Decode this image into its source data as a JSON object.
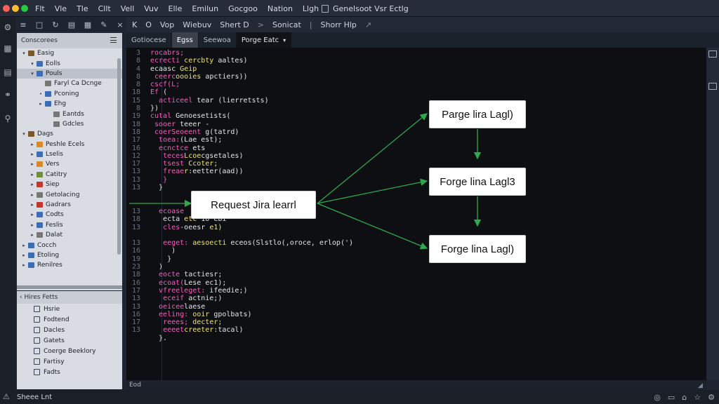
{
  "window": {
    "title": "Genelsoot Vsr Ectlg",
    "menu": [
      "Flt",
      "Vle",
      "Tle",
      "Cllt",
      "Vell",
      "Vuv",
      "Elle",
      "Emilun",
      "Gocgoo",
      "Nation",
      "Llgh"
    ]
  },
  "toolbar": {
    "items": [
      "K",
      "O",
      "Vop",
      "Wiebuv",
      "Shert D",
      "Sonicat",
      "Shorr Hlp"
    ],
    "separators": [
      ">",
      "|",
      "↗"
    ]
  },
  "panel_tools": [
    "≡",
    "□",
    "↻",
    "▤",
    "▦",
    "✎",
    "×"
  ],
  "tabs": {
    "items": [
      {
        "label": "Gotiocese",
        "active": false
      },
      {
        "label": "Egss",
        "active": true
      },
      {
        "label": "Seewoa",
        "active": false
      },
      {
        "label": "Porge Eatc",
        "active": false
      }
    ]
  },
  "explorer": {
    "title": "Conscorees",
    "tree": [
      {
        "label": "Easig",
        "depth": 0,
        "caret": "▾",
        "color": "#7a5a2a",
        "selected": false
      },
      {
        "label": "Eolls",
        "depth": 1,
        "caret": "▾",
        "color": "#3d6db3",
        "selected": false
      },
      {
        "label": "Pouls",
        "depth": 1,
        "caret": "▾",
        "color": "#3d6db3",
        "selected": true
      },
      {
        "label": "Faryl Ca Dcnge",
        "depth": 2,
        "caret": "",
        "color": "#777777",
        "selected": false
      },
      {
        "label": "Pconing",
        "depth": 2,
        "caret": "•",
        "color": "#3d6db3",
        "selected": false
      },
      {
        "label": "Ehg",
        "depth": 2,
        "caret": "▸",
        "color": "#3d6db3",
        "selected": false
      },
      {
        "label": "Eantds",
        "depth": 3,
        "caret": "",
        "color": "#777777",
        "selected": false
      },
      {
        "label": "Gdcles",
        "depth": 3,
        "caret": "",
        "color": "#777777",
        "selected": false
      },
      {
        "label": "Dags",
        "depth": 0,
        "caret": "▾",
        "color": "#7a5a2a",
        "selected": false
      },
      {
        "label": "Peshle Ecels",
        "depth": 1,
        "caret": "▸",
        "color": "#d9892a",
        "selected": false
      },
      {
        "label": "Lselis",
        "depth": 1,
        "caret": "▸",
        "color": "#3d6db3",
        "selected": false
      },
      {
        "label": "Vers",
        "depth": 1,
        "caret": "▸",
        "color": "#d9892a",
        "selected": false
      },
      {
        "label": "Catitry",
        "depth": 1,
        "caret": "▸",
        "color": "#6b8f3a",
        "selected": false
      },
      {
        "label": "Siep",
        "depth": 1,
        "caret": "▸",
        "color": "#c0392b",
        "selected": false
      },
      {
        "label": "Getolacing",
        "depth": 1,
        "caret": "▸",
        "color": "#777777",
        "selected": false
      },
      {
        "label": "Gadrars",
        "depth": 1,
        "caret": "▸",
        "color": "#c0392b",
        "selected": false
      },
      {
        "label": "Codts",
        "depth": 1,
        "caret": "▸",
        "color": "#3d6db3",
        "selected": false
      },
      {
        "label": "Feslis",
        "depth": 1,
        "caret": "▸",
        "color": "#3d6db3",
        "selected": false
      },
      {
        "label": "Dalat",
        "depth": 1,
        "caret": "▸",
        "color": "#777777",
        "selected": false
      },
      {
        "label": "Cocch",
        "depth": 0,
        "caret": "▸",
        "color": "#3d6db3",
        "selected": false
      },
      {
        "label": "Etoling",
        "depth": 0,
        "caret": "▸",
        "color": "#3d6db3",
        "selected": false
      },
      {
        "label": "Renilres",
        "depth": 0,
        "caret": "▸",
        "color": "#3d6db3",
        "selected": false
      }
    ]
  },
  "outline": {
    "title": "‹ Hires Fetts",
    "items": [
      "Hsrie",
      "Fodtend",
      "Dacles",
      "Gatets",
      "Coerge Beeklory",
      "Fartisy",
      "Fadts"
    ]
  },
  "code": {
    "lines": [
      {
        "n": "3",
        "parts": [
          [
            "kw",
            "rocabrs;"
          ]
        ]
      },
      {
        "n": "8",
        "parts": [
          [
            "kw",
            "ecrecti "
          ],
          [
            "fn",
            "cercbty "
          ],
          [
            "tx",
            "aaltes)"
          ]
        ]
      },
      {
        "n": "4",
        "parts": [
          [
            "tx",
            "ecaasc "
          ],
          [
            "fn",
            "Geip"
          ]
        ]
      },
      {
        "n": "8",
        "parts": [
          [
            "tx",
            " "
          ],
          [
            "kw",
            "ceerc"
          ],
          [
            "fn",
            "oooies "
          ],
          [
            "tx",
            "apctiers))"
          ]
        ]
      },
      {
        "n": "8",
        "parts": [
          [
            "kw",
            "cscf(L;"
          ]
        ]
      },
      {
        "n": "18",
        "parts": [
          [
            "kw",
            "Ef "
          ],
          [
            "tx",
            "("
          ]
        ]
      },
      {
        "n": "15",
        "parts": [
          [
            "tx",
            "  "
          ],
          [
            "kw",
            "acticeel "
          ],
          [
            "tx",
            "tear (lierretsts)"
          ]
        ]
      },
      {
        "n": "8",
        "parts": [
          [
            "tx",
            "})"
          ]
        ]
      },
      {
        "n": "19",
        "parts": [
          [
            "kw",
            "cutal "
          ],
          [
            "tx",
            "Genoesetists("
          ]
        ]
      },
      {
        "n": "18",
        "parts": [
          [
            "kw",
            " sooer "
          ],
          [
            "tx",
            "teeer -"
          ]
        ]
      },
      {
        "n": "18",
        "parts": [
          [
            "kw",
            " coerSeoeent "
          ],
          [
            "tx",
            "g(tatrd)"
          ]
        ]
      },
      {
        "n": "17",
        "parts": [
          [
            "kw",
            "  toea:"
          ],
          [
            "tx",
            "(Lae est);"
          ]
        ]
      },
      {
        "n": "16",
        "parts": [
          [
            "tx",
            "  "
          ],
          [
            "kw",
            "ecnctce "
          ],
          [
            "tx",
            "ets"
          ]
        ]
      },
      {
        "n": "12",
        "parts": [
          [
            "tx",
            "   "
          ],
          [
            "kw",
            "teces"
          ],
          [
            "fn",
            "Lcoe"
          ],
          [
            "tx",
            "cgsetales)"
          ]
        ]
      },
      {
        "n": "17",
        "parts": [
          [
            "tx",
            "   "
          ],
          [
            "kw",
            "tsest "
          ],
          [
            "fn",
            "Ccoter;"
          ]
        ]
      },
      {
        "n": "13",
        "parts": [
          [
            "tx",
            "   "
          ],
          [
            "kw",
            "freae"
          ],
          [
            "fn",
            "r:"
          ],
          [
            "tx",
            "eetter(aad))"
          ]
        ]
      },
      {
        "n": "13",
        "parts": [
          [
            "tx",
            "   "
          ],
          [
            "kw",
            "}"
          ]
        ]
      },
      {
        "n": "13",
        "parts": [
          [
            "tx",
            "  }"
          ]
        ]
      },
      {
        "n": "",
        "parts": []
      },
      {
        "n": "",
        "parts": []
      },
      {
        "n": "13",
        "parts": [
          [
            "kw",
            "  ecoase "
          ]
        ]
      },
      {
        "n": "18",
        "parts": [
          [
            "tx",
            "   ecta "
          ],
          [
            "fn",
            "etc "
          ],
          [
            "tx",
            "1o ebi"
          ]
        ]
      },
      {
        "n": "13",
        "parts": [
          [
            "tx",
            "   "
          ],
          [
            "kw",
            "cles"
          ],
          [
            "tx",
            "-oeesr "
          ],
          [
            "fn",
            "e1)"
          ]
        ]
      },
      {
        "n": "",
        "parts": []
      },
      {
        "n": "13",
        "parts": [
          [
            "tx",
            "   "
          ],
          [
            "kw",
            "eeget: "
          ],
          [
            "fn",
            "aesoecti "
          ],
          [
            "tx",
            "eceos(Slstlo(,oroce, erlop(')"
          ]
        ]
      },
      {
        "n": "16",
        "parts": [
          [
            "tx",
            "     )"
          ]
        ]
      },
      {
        "n": "19",
        "parts": [
          [
            "tx",
            "    }"
          ]
        ]
      },
      {
        "n": "23",
        "parts": [
          [
            "tx",
            "  )"
          ]
        ]
      },
      {
        "n": "18",
        "parts": [
          [
            "kw",
            "  eocte "
          ],
          [
            "tx",
            "tactiesr;"
          ]
        ]
      },
      {
        "n": "16",
        "parts": [
          [
            "kw",
            "  ecoat("
          ],
          [
            "tx",
            "Lese ec1);"
          ]
        ]
      },
      {
        "n": "17",
        "parts": [
          [
            "tx",
            "  "
          ],
          [
            "kw",
            "vfreeleget: "
          ],
          [
            "tx",
            "ifeedie;)"
          ]
        ]
      },
      {
        "n": "13",
        "parts": [
          [
            "tx",
            "   "
          ],
          [
            "kw",
            "eceif "
          ],
          [
            "tx",
            "actnie;)"
          ]
        ]
      },
      {
        "n": "13",
        "parts": [
          [
            "kw",
            "  oeicee"
          ],
          [
            "tx",
            "laese"
          ]
        ]
      },
      {
        "n": "16",
        "parts": [
          [
            "kw",
            "  eeling: "
          ],
          [
            "fn",
            "ooir "
          ],
          [
            "tx",
            "gpolbats)"
          ]
        ]
      },
      {
        "n": "17",
        "parts": [
          [
            "tx",
            "   "
          ],
          [
            "kw",
            "reees; "
          ],
          [
            "fn",
            "decter;"
          ]
        ]
      },
      {
        "n": "13",
        "parts": [
          [
            "tx",
            "   "
          ],
          [
            "kw",
            "eeeet"
          ],
          [
            "fn",
            "creeter:"
          ],
          [
            "tx",
            "tacal)"
          ]
        ]
      },
      {
        "n": "",
        "parts": [
          [
            "tx",
            "  }."
          ]
        ]
      }
    ]
  },
  "flow": {
    "request": "Request Jira learrl",
    "box1": "Parge lira Lagl)",
    "box2": "Forge lina Lagl3",
    "box3": "Forge lina Lagl)",
    "arrow_color": "#2fa84f"
  },
  "editor_status": "Eod",
  "status": {
    "text": "Sheee Lnt",
    "right_icons": [
      "◎",
      "▭",
      "⌂",
      "☆",
      "⚙"
    ]
  }
}
